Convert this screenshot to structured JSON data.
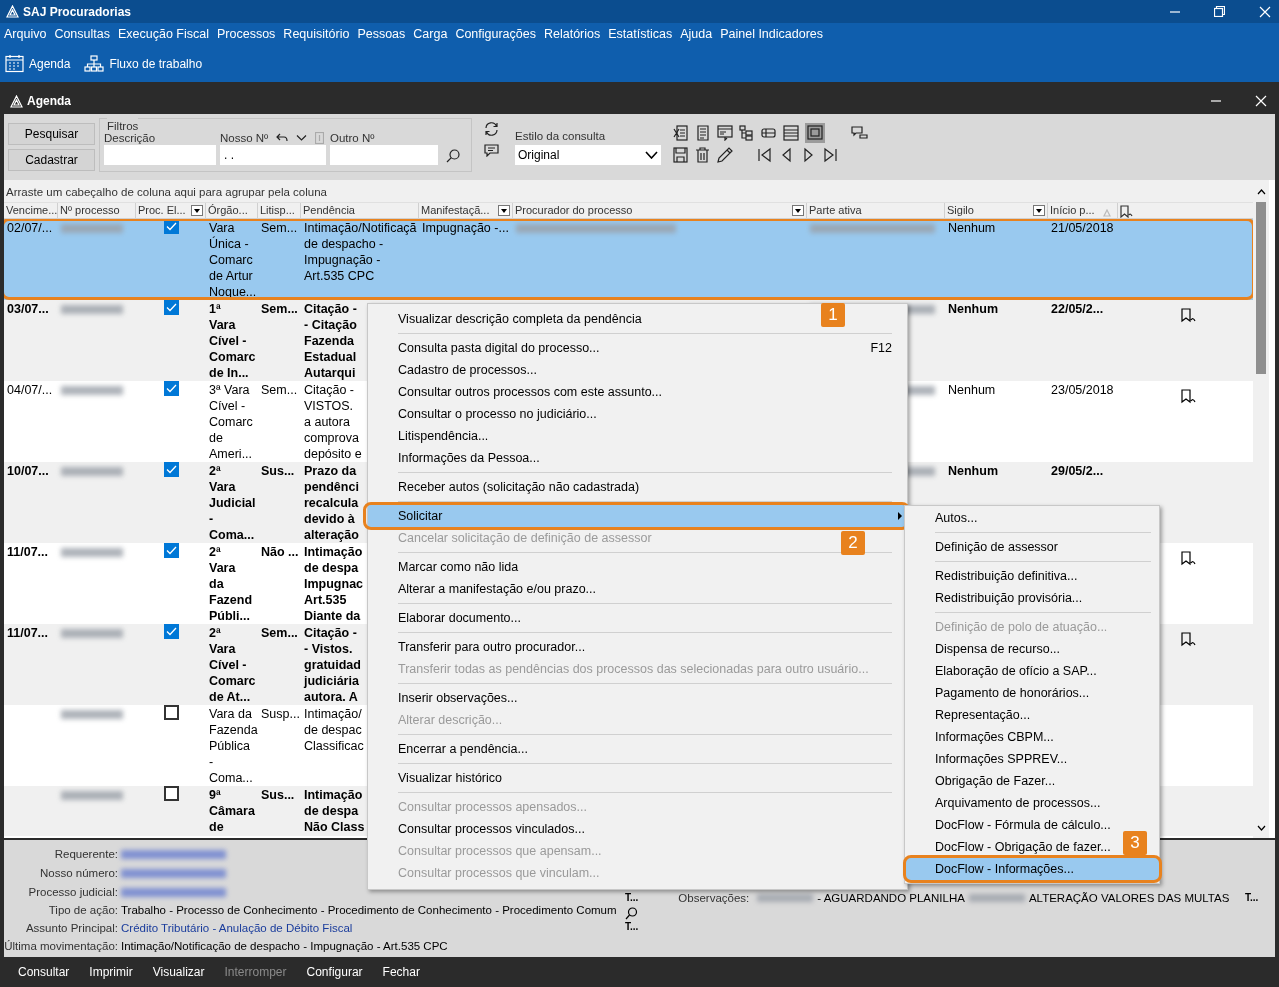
{
  "app": {
    "title": "SAJ Procuradorias"
  },
  "menu_bar": [
    "Arquivo",
    "Consultas",
    "Execução Fiscal",
    "Processos",
    "Requisitório",
    "Pessoas",
    "Carga",
    "Configurações",
    "Relatórios",
    "Estatísticas",
    "Ajuda",
    "Painel Indicadores"
  ],
  "toolbar": [
    {
      "kind": "calendar",
      "label": "Agenda"
    },
    {
      "kind": "workflow",
      "label": "Fluxo de trabalho"
    }
  ],
  "window": {
    "title": "Agenda"
  },
  "filters": {
    "buttons": [
      "Pesquisar",
      "Cadastrar"
    ],
    "group_title": "Filtros",
    "fields": [
      {
        "kind": "text",
        "label": "Descrição"
      },
      {
        "kind": "masked",
        "label": "Nosso Nº",
        "value": ". ."
      },
      {
        "kind": "text",
        "label": "Outro Nº"
      }
    ],
    "style_label": "Estilo da consulta",
    "style_value": "Original",
    "grid_view_pressed": true
  },
  "grid": {
    "group_hint": "Arraste um cabeçalho de coluna aqui para agrupar pela coluna",
    "columns": [
      {
        "label": "Vencime..."
      },
      {
        "label": "Nº processo"
      },
      {
        "label": "Proc. El...",
        "filter": true
      },
      {
        "label": "Órgão..."
      },
      {
        "label": "Litisp..."
      },
      {
        "label": "Pendência"
      },
      {
        "label": "Manifestaçã...",
        "filter": true
      },
      {
        "label": "Procurador do processo",
        "filter": true
      },
      {
        "label": "Parte ativa"
      },
      {
        "label": "Sigilo",
        "filter": true
      },
      {
        "label": "Início p...",
        "sorted": true
      }
    ],
    "rows": [
      {
        "selected": true,
        "unread": false,
        "checked": true,
        "callout": "1",
        "blur_process": true,
        "blur_procurador": true,
        "blur_parte": true,
        "cells": {
          "due": "02/07/...",
          "organ": [
            "Vara",
            "Única -",
            "Comarc",
            "de Artur",
            "Noque..."
          ],
          "litisp": "Sem...",
          "pendencia": [
            "Intimação/Notificaçã",
            "de despacho -",
            "Impugnação -",
            "Art.535 CPC"
          ],
          "manifestacao": "Impugnação -...",
          "sigilo": "Nenhum",
          "inicio": "21/05/2018"
        }
      },
      {
        "selected": false,
        "unread": true,
        "checked": true,
        "bookmark": true,
        "blur_process": true,
        "blur_parte": true,
        "cells": {
          "due": "03/07...",
          "organ": [
            "1ª",
            "Vara",
            "Cível -",
            "Comarc",
            "de In..."
          ],
          "litisp": "Sem...",
          "pendencia": [
            "Citação -",
            "- Citação",
            "Fazenda",
            "Estadual",
            "Autarqui"
          ],
          "sigilo": "Nenhum",
          "inicio": "22/05/2..."
        }
      },
      {
        "selected": false,
        "unread": false,
        "checked": true,
        "bookmark": true,
        "blur_process": true,
        "blur_parte": true,
        "cells": {
          "due": "04/07/...",
          "organ": [
            "3ª Vara",
            "Cível -",
            "Comarc",
            "de",
            "Ameri..."
          ],
          "litisp": "Sem...",
          "pendencia": [
            "Citação -",
            "VISTOS.",
            "a autora",
            "comprova",
            "depósito e"
          ],
          "sigilo": "Nenhum",
          "inicio": "23/05/2018"
        }
      },
      {
        "selected": false,
        "unread": true,
        "checked": true,
        "blur_process": true,
        "blur_parte": true,
        "cells": {
          "due": "10/07...",
          "organ": [
            "2ª",
            "Vara",
            "Judicial",
            "-",
            "Coma..."
          ],
          "litisp": "Sus...",
          "pendencia": [
            "Prazo da",
            "pendênci",
            "recalcula",
            "devido à",
            "alteração"
          ],
          "sigilo": "Nenhum",
          "inicio": "29/05/2..."
        }
      },
      {
        "selected": false,
        "unread": true,
        "checked": true,
        "bookmark": true,
        "blur_process": true,
        "cells": {
          "due": "11/07...",
          "organ": [
            "2ª",
            "Vara",
            "da",
            "Fazend",
            "Públi..."
          ],
          "litisp": "Não ...",
          "pendencia": [
            "Intimação",
            "de despa",
            "Impugnac",
            "Art.535",
            "Diante da"
          ]
        }
      },
      {
        "selected": false,
        "unread": true,
        "checked": true,
        "bookmark": true,
        "blur_process": true,
        "cells": {
          "due": "11/07...",
          "organ": [
            "2ª",
            "Vara",
            "Cível -",
            "Comarc",
            "de At..."
          ],
          "litisp": "Sem...",
          "pendencia": [
            "Citação -",
            "- Vistos.",
            "gratuidad",
            "judiciária",
            "autora. A"
          ]
        }
      },
      {
        "selected": false,
        "unread": false,
        "checked": false,
        "blur_process": true,
        "cells": {
          "organ": [
            "Vara da",
            "Fazenda",
            "Pública",
            "-",
            "Coma..."
          ],
          "litisp": "Susp...",
          "pendencia": [
            "Intimação/",
            "de despac",
            "Classificac"
          ]
        }
      },
      {
        "selected": false,
        "unread": true,
        "checked": false,
        "blur_process": true,
        "cells": {
          "organ": [
            "9ª",
            "Câmara",
            "de"
          ],
          "litisp": "Sus...",
          "pendencia": [
            "Intimação",
            "de despa",
            "Não Class"
          ]
        }
      }
    ]
  },
  "context_menu": {
    "items": [
      {
        "kind": "item",
        "label": "Visualizar descrição completa da pendência",
        "disabled": false,
        "selected": false
      },
      {
        "kind": "separator"
      },
      {
        "kind": "item",
        "label": "Consulta pasta digital do processo...",
        "shortcut": "F12",
        "disabled": false,
        "selected": false
      },
      {
        "kind": "item",
        "label": "Cadastro de processos...",
        "disabled": false,
        "selected": false
      },
      {
        "kind": "item",
        "label": "Consultar outros processos com este assunto...",
        "disabled": false,
        "selected": false
      },
      {
        "kind": "item",
        "label": "Consultar o processo no judiciário...",
        "disabled": false,
        "selected": false
      },
      {
        "kind": "item",
        "label": "Litispendência...",
        "disabled": false,
        "selected": false
      },
      {
        "kind": "item",
        "label": "Informações da Pessoa...",
        "disabled": false,
        "selected": false
      },
      {
        "kind": "separator"
      },
      {
        "kind": "item",
        "label": "Receber autos (solicitação não cadastrada)",
        "disabled": false,
        "selected": false
      },
      {
        "kind": "separator"
      },
      {
        "kind": "item",
        "label": "Solicitar",
        "submenu": true,
        "disabled": false,
        "selected": true,
        "callout": "2"
      },
      {
        "kind": "item",
        "label": "Cancelar solicitação de definição de assessor",
        "disabled": true,
        "selected": false
      },
      {
        "kind": "separator"
      },
      {
        "kind": "item",
        "label": "Marcar como não lida",
        "disabled": false,
        "selected": false
      },
      {
        "kind": "item",
        "label": "Alterar a manifestação e/ou prazo...",
        "disabled": false,
        "selected": false
      },
      {
        "kind": "separator"
      },
      {
        "kind": "item",
        "label": "Elaborar documento...",
        "disabled": false,
        "selected": false
      },
      {
        "kind": "separator"
      },
      {
        "kind": "item",
        "label": "Transferir para outro procurador...",
        "disabled": false,
        "selected": false
      },
      {
        "kind": "item",
        "label": "Transferir todas as pendências dos processos das selecionadas para outro usuário...",
        "disabled": true,
        "selected": false
      },
      {
        "kind": "separator"
      },
      {
        "kind": "item",
        "label": "Inserir observações...",
        "disabled": false,
        "selected": false
      },
      {
        "kind": "item",
        "label": "Alterar descrição...",
        "disabled": true,
        "selected": false
      },
      {
        "kind": "separator"
      },
      {
        "kind": "item",
        "label": "Encerrar a pendência...",
        "disabled": false,
        "selected": false
      },
      {
        "kind": "separator"
      },
      {
        "kind": "item",
        "label": "Visualizar histórico",
        "disabled": false,
        "selected": false
      },
      {
        "kind": "separator"
      },
      {
        "kind": "item",
        "label": "Consultar processos apensados...",
        "disabled": true,
        "selected": false
      },
      {
        "kind": "item",
        "label": "Consultar processos vinculados...",
        "disabled": false,
        "selected": false
      },
      {
        "kind": "item",
        "label": "Consultar processos que apensam...",
        "disabled": true,
        "selected": false
      },
      {
        "kind": "item",
        "label": "Consultar processos que vinculam...",
        "disabled": true,
        "selected": false
      }
    ]
  },
  "submenu": {
    "items": [
      {
        "kind": "item",
        "label": "Autos...",
        "disabled": false,
        "selected": false
      },
      {
        "kind": "separator"
      },
      {
        "kind": "item",
        "label": "Definição de assessor",
        "disabled": false,
        "selected": false
      },
      {
        "kind": "separator"
      },
      {
        "kind": "item",
        "label": "Redistribuição definitiva...",
        "disabled": false,
        "selected": false
      },
      {
        "kind": "item",
        "label": "Redistribuição provisória...",
        "disabled": false,
        "selected": false
      },
      {
        "kind": "separator"
      },
      {
        "kind": "item",
        "label": "Definição de polo de atuação...",
        "disabled": true,
        "selected": false
      },
      {
        "kind": "item",
        "label": "Dispensa de recurso...",
        "disabled": false,
        "selected": false
      },
      {
        "kind": "item",
        "label": "Elaboração de ofício a SAP...",
        "disabled": false,
        "selected": false
      },
      {
        "kind": "item",
        "label": "Pagamento de honorários...",
        "disabled": false,
        "selected": false
      },
      {
        "kind": "item",
        "label": "Representação...",
        "disabled": false,
        "selected": false
      },
      {
        "kind": "item",
        "label": "Informações CBPM...",
        "disabled": false,
        "selected": false
      },
      {
        "kind": "item",
        "label": "Informações SPPREV...",
        "disabled": false,
        "selected": false
      },
      {
        "kind": "item",
        "label": "Obrigação de Fazer...",
        "disabled": false,
        "selected": false
      },
      {
        "kind": "item",
        "label": "Arquivamento de processos...",
        "disabled": false,
        "selected": false
      },
      {
        "kind": "item",
        "label": "DocFlow - Fórmula de cálculo...",
        "disabled": false,
        "selected": false
      },
      {
        "kind": "item",
        "label": "DocFlow - Obrigação de fazer...",
        "disabled": false,
        "selected": false
      },
      {
        "kind": "item",
        "label": "DocFlow - Informações...",
        "disabled": false,
        "selected": true,
        "callout": "3"
      }
    ]
  },
  "details": {
    "fields": [
      {
        "label": "Requerente:",
        "redacted": true
      },
      {
        "label": "Nosso número:",
        "redacted": true
      },
      {
        "label": "Processo judicial:",
        "redacted": true
      },
      {
        "label": "Tipo de ação:",
        "value": "Trabalho - Processo de Conhecimento - Procedimento de Conhecimento - Procedimento Comum"
      },
      {
        "label": "Assunto Principal:",
        "value": "Crédito Tributário - Anulação de Débito Fiscal",
        "link": true
      },
      {
        "label": "Última movimentação:",
        "value": "Intimação/Notificação de despacho - Impugnação - Art.535 CPC"
      }
    ],
    "more_links": [
      "T...",
      "T..."
    ],
    "observations": {
      "label": "Observações:",
      "parts": [
        {
          "redacted": true
        },
        {
          "text": "- AGUARDANDO PLANILHA"
        },
        {
          "redacted": true
        },
        {
          "text": "ALTERAÇÃO VALORES DAS MULTAS"
        }
      ],
      "more": "T..."
    }
  },
  "footer_buttons": [
    {
      "label": "Consultar",
      "disabled": false
    },
    {
      "label": "Imprimir",
      "disabled": false
    },
    {
      "label": "Visualizar",
      "disabled": false
    },
    {
      "label": "Interromper",
      "disabled": true
    },
    {
      "label": "Configurar",
      "disabled": false
    },
    {
      "label": "Fechar",
      "disabled": false
    }
  ]
}
